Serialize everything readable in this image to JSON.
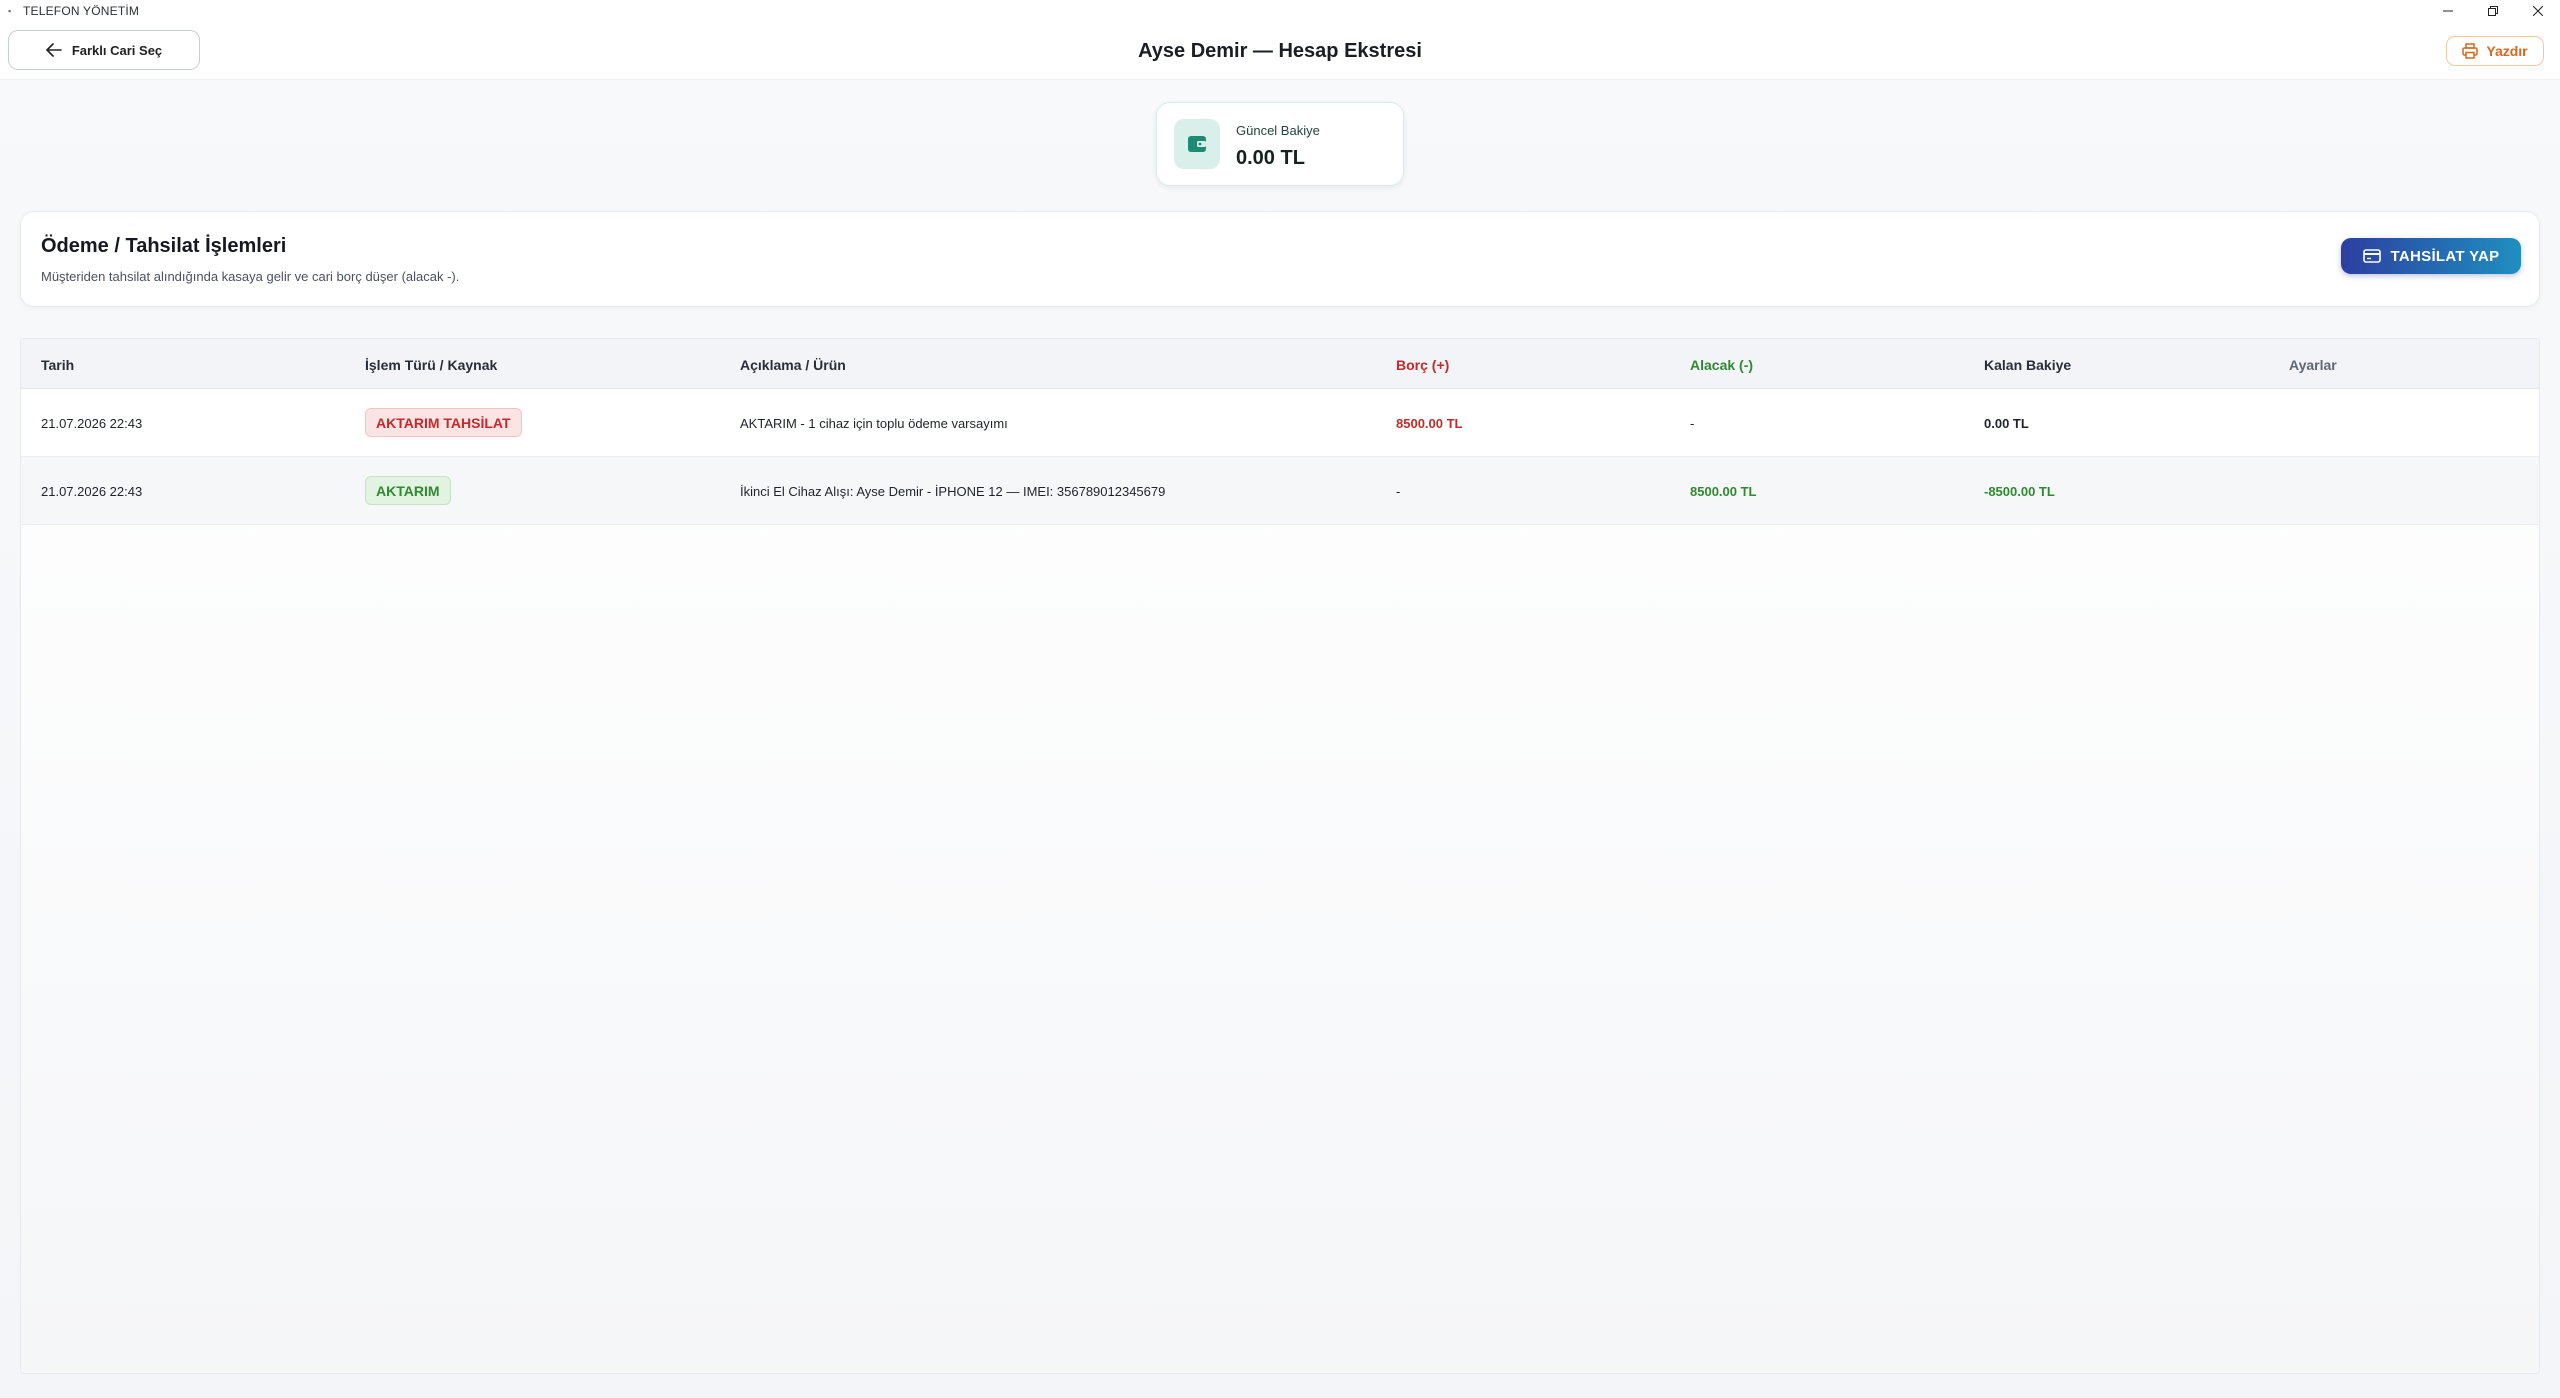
{
  "window": {
    "title": "TELEFON YÖNETİM"
  },
  "header": {
    "back_label": "Farklı Cari Seç",
    "title": "Ayse Demir — Hesap Ekstresi",
    "print_label": "Yazdır"
  },
  "balance": {
    "label": "Güncel Bakiye",
    "value": "0.00 TL"
  },
  "payment": {
    "title": "Ödeme / Tahsilat İşlemleri",
    "subtitle": "Müşteriden tahsilat alındığında kasaya gelir ve cari borç düşer (alacak -).",
    "button_label": "TAHSİLAT YAP"
  },
  "table": {
    "columns": {
      "date": "Tarih",
      "type": "İşlem Türü / Kaynak",
      "desc": "Açıklama / Ürün",
      "debit": "Borç (+)",
      "credit": "Alacak (-)",
      "balance": "Kalan Bakiye",
      "settings": "Ayarlar"
    },
    "rows": [
      {
        "date": "21.07.2026 22:43",
        "type": "AKTARIM TAHSİLAT",
        "desc": "AKTARIM - 1 cihaz için toplu ödeme varsayımı",
        "debit": "8500.00 TL",
        "credit": "-",
        "balance": "0.00 TL"
      },
      {
        "date": "21.07.2026 22:43",
        "type": "AKTARIM",
        "desc": "İkinci El Cihaz Alışı: Ayse Demir - İPHONE 12 — IMEI: 356789012345679",
        "debit": "-",
        "credit": "8500.00 TL",
        "balance": "-8500.00 TL"
      }
    ]
  },
  "colors": {
    "accent_debit": "#c42a2a",
    "accent_credit": "#2f8a2f",
    "print_orange": "#d9661a",
    "button_gradient_start": "#2d3fa0",
    "button_gradient_end": "#1f8fc0"
  },
  "icons": {
    "back": "arrow-left-icon",
    "print": "printer-icon",
    "balance": "wallet-icon",
    "collect": "credit-card-icon"
  }
}
